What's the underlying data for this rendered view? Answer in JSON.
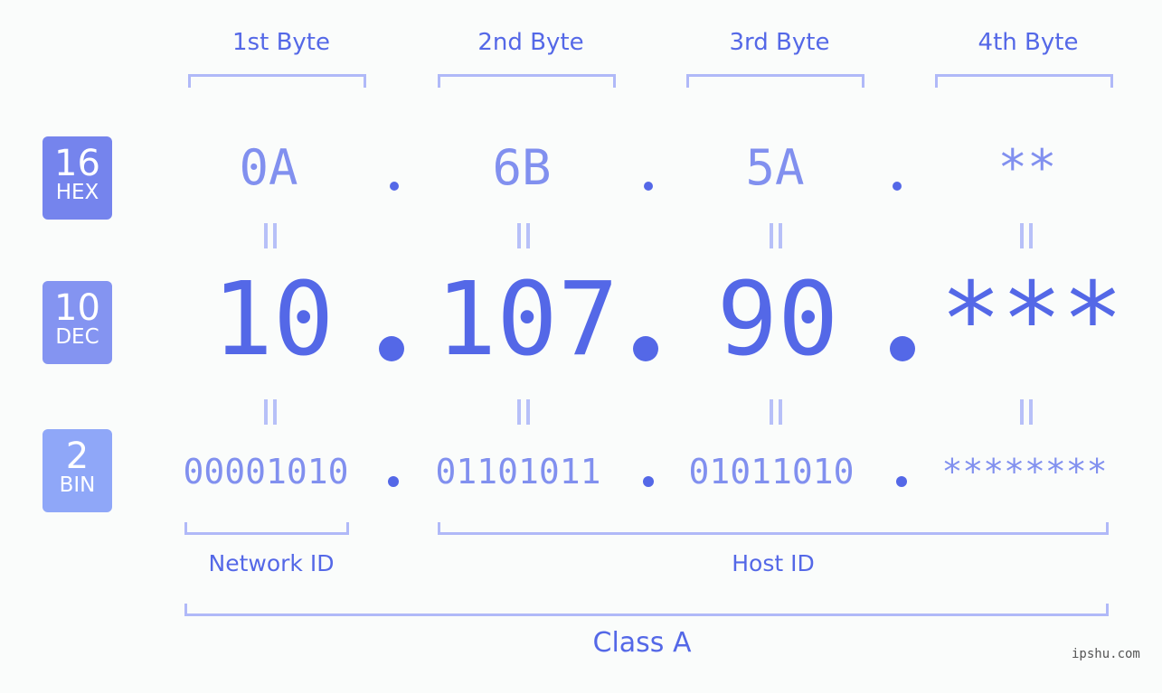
{
  "bytes": {
    "labels": [
      "1st Byte",
      "2nd Byte",
      "3rd Byte",
      "4th Byte"
    ]
  },
  "badges": {
    "hex": {
      "num": "16",
      "unit": "HEX",
      "color": "#7584ed"
    },
    "dec": {
      "num": "10",
      "unit": "DEC",
      "color": "#8494f1"
    },
    "bin": {
      "num": "2",
      "unit": "BIN",
      "color": "#8fa7f8"
    }
  },
  "hex": [
    "0A",
    "6B",
    "5A",
    "**"
  ],
  "dec": [
    "10",
    "107",
    "90",
    "***"
  ],
  "bin": [
    "00001010",
    "01101011",
    "01011010",
    "********"
  ],
  "sections": {
    "network_id": "Network ID",
    "host_id": "Host ID",
    "class": "Class A"
  },
  "watermark": "ipshu.com",
  "colors": {
    "accent": "#5468e7",
    "light_accent": "#8190ef",
    "bracket": "#b0b9f8",
    "background": "#fafcfb"
  }
}
